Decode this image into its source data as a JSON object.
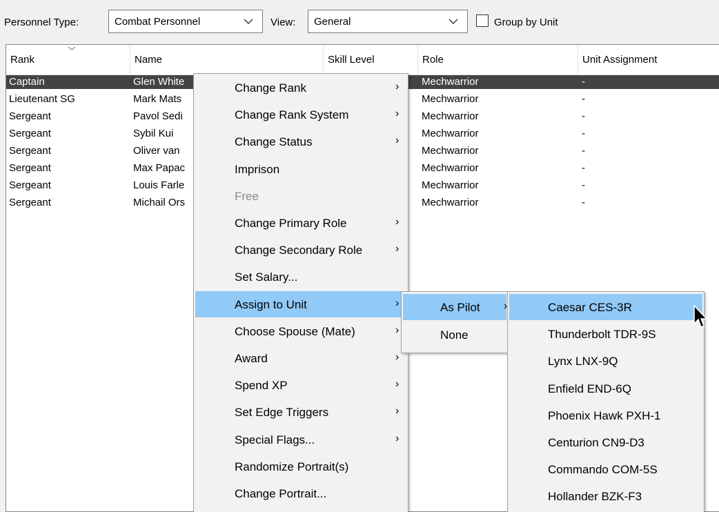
{
  "toolbar": {
    "personnel_type_label": "Personnel Type:",
    "personnel_type_value": "Combat Personnel",
    "view_label": "View:",
    "view_value": "General",
    "group_by_unit_label": "Group by Unit",
    "group_by_unit_checked": false
  },
  "table": {
    "columns": [
      "Rank",
      "Name",
      "Skill Level",
      "Role",
      "Unit Assignment"
    ],
    "rows": [
      {
        "rank": "Captain",
        "name": "Glen White",
        "role": "Mechwarrior",
        "unit": "-",
        "selected": true
      },
      {
        "rank": "Lieutenant SG",
        "name": "Mark Mats",
        "role": "Mechwarrior",
        "unit": "-"
      },
      {
        "rank": "Sergeant",
        "name": "Pavol Sedi",
        "role": "Mechwarrior",
        "unit": "-"
      },
      {
        "rank": "Sergeant",
        "name": "Sybil Kui",
        "role": "Mechwarrior",
        "unit": "-"
      },
      {
        "rank": "Sergeant",
        "name": "Oliver van",
        "role": "Mechwarrior",
        "unit": "-"
      },
      {
        "rank": "Sergeant",
        "name": "Max Papac",
        "role": "Mechwarrior",
        "unit": "-"
      },
      {
        "rank": "Sergeant",
        "name": "Louis Farle",
        "role": "Mechwarrior",
        "unit": "-"
      },
      {
        "rank": "Sergeant",
        "name": "Michail Ors",
        "role": "Mechwarrior",
        "unit": "-"
      }
    ]
  },
  "context_menu": {
    "items": [
      {
        "label": "Change Rank",
        "submenu": true
      },
      {
        "label": "Change Rank System",
        "submenu": true
      },
      {
        "label": "Change Status",
        "submenu": true
      },
      {
        "label": "Imprison",
        "submenu": false
      },
      {
        "label": "Free",
        "submenu": false,
        "disabled": true
      },
      {
        "label": "Change Primary Role",
        "submenu": true
      },
      {
        "label": "Change Secondary Role",
        "submenu": true
      },
      {
        "label": "Set Salary...",
        "submenu": false
      },
      {
        "label": "Assign to Unit",
        "submenu": true,
        "highlighted": true
      },
      {
        "label": "Choose Spouse (Mate)",
        "submenu": true
      },
      {
        "label": "Award",
        "submenu": true
      },
      {
        "label": "Spend XP",
        "submenu": true
      },
      {
        "label": "Set Edge Triggers",
        "submenu": true
      },
      {
        "label": "Special Flags...",
        "submenu": true
      },
      {
        "label": "Randomize Portrait(s)",
        "submenu": false
      },
      {
        "label": "Change Portrait...",
        "submenu": false
      }
    ]
  },
  "assign_submenu": {
    "items": [
      {
        "label": "As Pilot",
        "submenu": true,
        "highlighted": true
      },
      {
        "label": "None",
        "submenu": false
      }
    ]
  },
  "pilot_submenu": {
    "items": [
      {
        "label": "Caesar CES-3R",
        "highlighted": true
      },
      {
        "label": "Thunderbolt TDR-9S"
      },
      {
        "label": "Lynx LNX-9Q"
      },
      {
        "label": "Enfield END-6Q"
      },
      {
        "label": "Phoenix Hawk PXH-1"
      },
      {
        "label": "Centurion CN9-D3"
      },
      {
        "label": "Commando COM-5S"
      },
      {
        "label": "Hollander BZK-F3"
      }
    ]
  },
  "colors": {
    "selected_row": "#434343",
    "menu_highlight": "#91c9f7",
    "menu_background": "#f2f2f2"
  }
}
